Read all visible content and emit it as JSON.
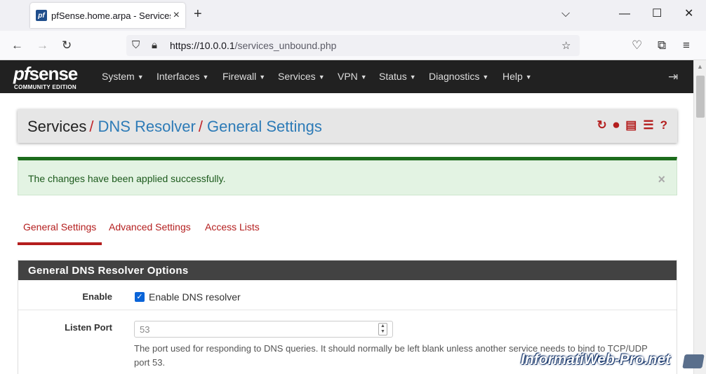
{
  "browser": {
    "tab_title": "pfSense.home.arpa - Services: D",
    "tab_favicon": "pf",
    "new_tab": "+",
    "url_scheme_host": "https://10.0.0.1",
    "url_path": "/services_unbound.php"
  },
  "nav": {
    "logo_word_pf": "pf",
    "logo_word_sense": "sense",
    "logo_edition": "COMMUNITY EDITION",
    "menus": [
      "System",
      "Interfaces",
      "Firewall",
      "Services",
      "VPN",
      "Status",
      "Diagnostics",
      "Help"
    ]
  },
  "breadcrumb": {
    "root": "Services",
    "sep": "/",
    "item1": "DNS Resolver",
    "item2": "General Settings"
  },
  "alert": {
    "message": "The changes have been applied successfully.",
    "close": "×"
  },
  "tabs": [
    "General Settings",
    "Advanced Settings",
    "Access Lists"
  ],
  "panel": {
    "title": "General DNS Resolver Options",
    "enable_label": "Enable",
    "enable_checkbox_label": "Enable DNS resolver",
    "enable_checked": true,
    "listen_port_label": "Listen Port",
    "listen_port_placeholder": "53",
    "listen_port_help": "The port used for responding to DNS queries. It should normally be left blank unless another service needs to bind to TCP/UDP port 53."
  },
  "watermark": "InformatiWeb-Pro.net",
  "colors": {
    "accent": "#b41e1e",
    "link": "#2d7bb7",
    "nav_bg": "#212121",
    "alert_bg": "#e3f3e3",
    "alert_border": "#1c6c1c"
  }
}
